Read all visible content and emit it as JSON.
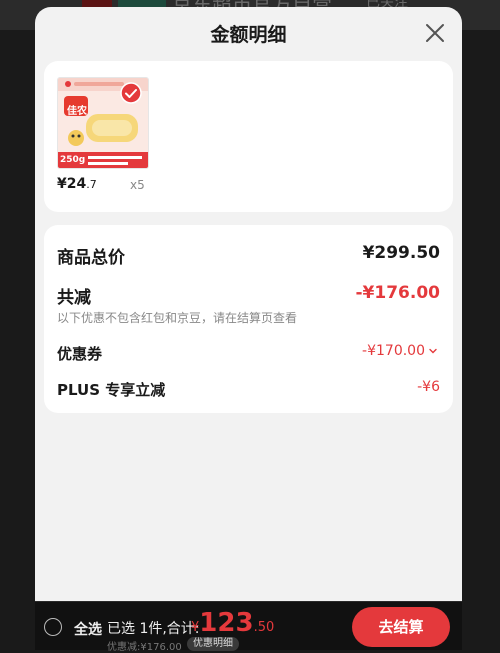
{
  "background": {
    "title": "京东超市官方自营",
    "right_text": "已关注"
  },
  "sheet": {
    "title": "金额明细"
  },
  "products": [
    {
      "brand": "佳农",
      "weight": "250g",
      "price_int": "¥24",
      "price_dec": ".7",
      "qty": "x5",
      "checked": true
    }
  ],
  "summary": {
    "total_label": "商品总价",
    "total_value": "¥299.50",
    "reduce_label": "共减",
    "reduce_value": "-¥176.00",
    "reduce_note": "以下优惠不包含红包和京豆，请在结算页查看",
    "coupon_label": "优惠券",
    "coupon_value": "-¥170.00",
    "plus_label": "PLUS 专享立减",
    "plus_value": "-¥6"
  },
  "bottom_bar": {
    "select_all_label": "全选",
    "selected_text": "已选 1件,合计:",
    "total_symbol": "¥",
    "total_int": "123",
    "total_dec": ".50",
    "discount_line": "优惠减:¥176.00",
    "detail_tag": "优惠明细",
    "checkout_label": "去结算"
  },
  "colors": {
    "accent": "#e4393c",
    "sheet_bg": "#f2f2f2",
    "bottom_bg": "#111111"
  }
}
